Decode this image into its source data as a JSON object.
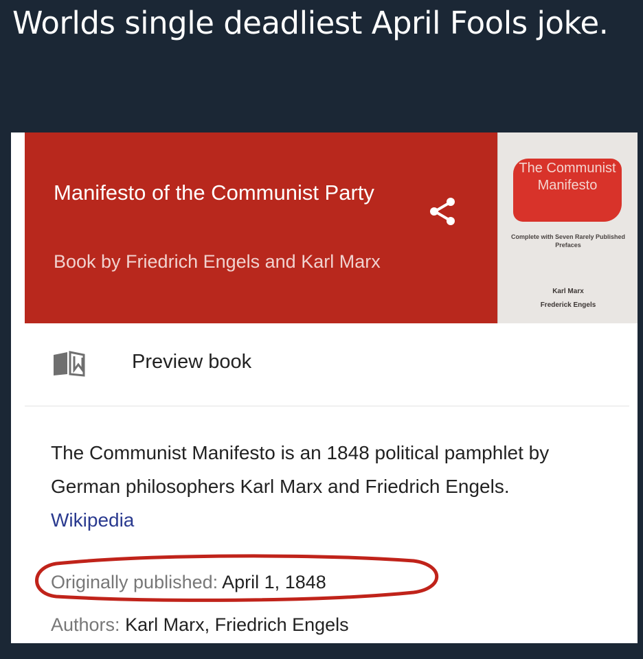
{
  "caption": "Worlds single deadliest April Fools joke.",
  "knowledge_panel": {
    "title": "Manifesto of the Communist Party",
    "subtitle": "Book by Friedrich Engels and Karl Marx",
    "cover": {
      "title": "The Communist Manifesto",
      "subtitle": "Complete with Seven Rarely Published Prefaces",
      "authors": [
        "Karl Marx",
        "Frederick Engels"
      ]
    },
    "preview_label": "Preview book",
    "description": "The Communist Manifesto is an 1848 political pamphlet by German philosophers Karl Marx and Friedrich Engels.",
    "wiki_link": "Wikipedia",
    "fields": {
      "published_key": "Originally published:",
      "published_value": "April 1, 1848",
      "authors_key": "Authors:",
      "authors_value": "Karl Marx, Friedrich Engels"
    }
  },
  "colors": {
    "background": "#1b2735",
    "header": "#b8281d",
    "link": "#2a3a8f",
    "annotation": "#c0231a"
  },
  "icons": [
    "share-icon",
    "book-icon"
  ]
}
